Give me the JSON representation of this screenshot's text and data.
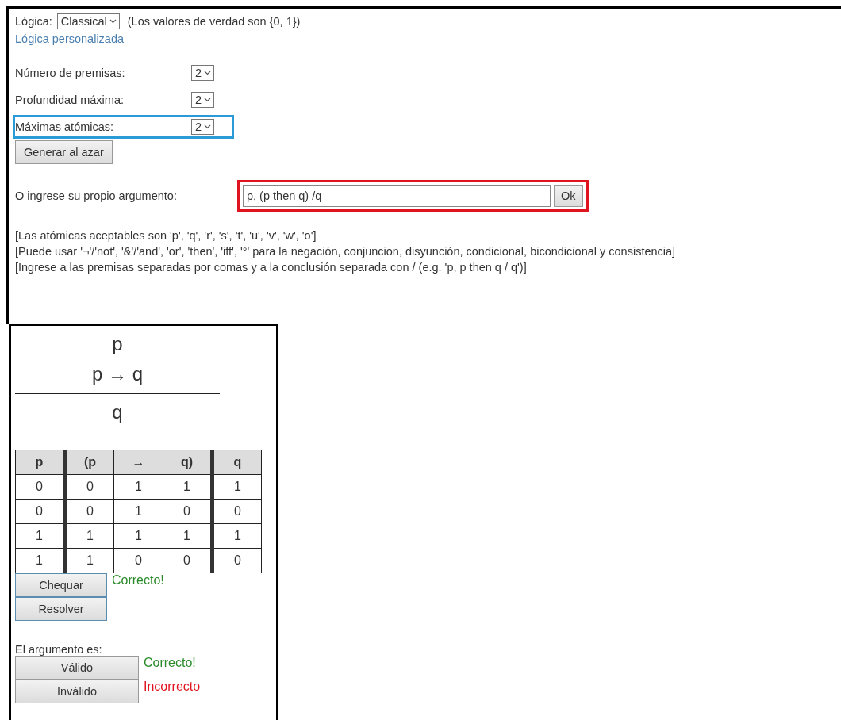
{
  "logic": {
    "label": "Lógica:",
    "value": "Classical",
    "note": "(Los valores de verdad son {0, 1})"
  },
  "custom_logic_link": "Lógica personalizada",
  "settings": [
    {
      "label": "Número de premisas:",
      "value": "2",
      "highlighted": false
    },
    {
      "label": "Profundidad máxima:",
      "value": "2",
      "highlighted": false
    },
    {
      "label": "Máximas atómicas:",
      "value": "2",
      "highlighted": true
    }
  ],
  "generate_button": "Generar al azar",
  "argument": {
    "label": "O ingrese su propio argumento:",
    "value": "p, (p then q) /q",
    "button": "Ok",
    "highlighted": true
  },
  "hints": [
    "[Las atómicas aceptables son 'p', 'q', 'r', 's', 't', 'u', 'v', 'w', 'o']",
    "[Puede usar '¬'/'not', '&'/'and', 'or', 'then', 'iff', '°' para la negación, conjuncion, disyunción, condicional, bicondicional y consistencia]",
    "[Ingrese a las premisas separadas por comas y a la conclusión separada con / (e.g. 'p, p then q / q')]"
  ],
  "argument_display": {
    "premises": [
      "p",
      "p → q"
    ],
    "conclusion": "q"
  },
  "truth_table": {
    "columns": [
      {
        "label": "p",
        "divider_after": true
      },
      {
        "label": "(p",
        "divider_after": false
      },
      {
        "label": "→",
        "divider_after": false
      },
      {
        "label": "q)",
        "divider_after": true
      },
      {
        "label": "q",
        "divider_after": false
      }
    ],
    "rows": [
      [
        "0",
        "0",
        "1",
        "1",
        "1"
      ],
      [
        "0",
        "0",
        "1",
        "0",
        "0"
      ],
      [
        "1",
        "1",
        "1",
        "1",
        "1"
      ],
      [
        "1",
        "1",
        "0",
        "0",
        "0"
      ]
    ]
  },
  "table_actions": [
    {
      "label": "Chequar",
      "feedback": "Correcto!",
      "color": "#2a8a2a"
    },
    {
      "label": "Resolver"
    }
  ],
  "validity": {
    "prompt": "El argumento es:",
    "options": [
      {
        "label": "Válido",
        "feedback": "Correcto!",
        "color": "#2a8a2a"
      },
      {
        "label": "Inválido",
        "feedback": "Incorrecto",
        "color": "#e0141e"
      }
    ]
  }
}
